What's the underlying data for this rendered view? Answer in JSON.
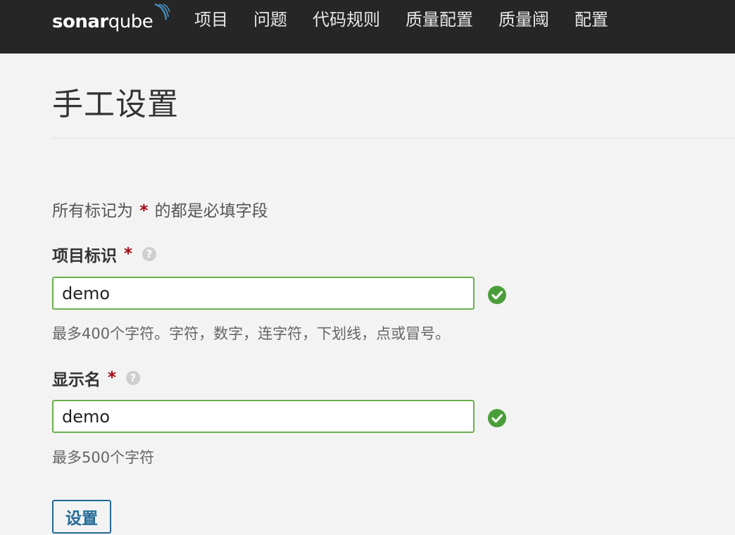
{
  "nav": {
    "logo": {
      "part1": "sonar",
      "part2": "qube"
    },
    "items": [
      {
        "label": "项目"
      },
      {
        "label": "问题"
      },
      {
        "label": "代码规则"
      },
      {
        "label": "质量配置"
      },
      {
        "label": "质量阈"
      },
      {
        "label": "配置"
      }
    ]
  },
  "page": {
    "title": "手工设置",
    "required_note_prefix": "所有标记为",
    "required_star": "*",
    "required_note_suffix": "的都是必填字段"
  },
  "form": {
    "project_key": {
      "label": "项目标识",
      "star": "*",
      "value": "demo",
      "hint": "最多400个字符。字符，数字，连字符，下划线，点或冒号。"
    },
    "display_name": {
      "label": "显示名",
      "star": "*",
      "value": "demo",
      "hint": "最多500个字符"
    },
    "submit_label": "设置"
  },
  "icons": {
    "help": "question-circle-icon",
    "valid": "check-circle-icon"
  },
  "colors": {
    "navbar": "#262626",
    "valid_green": "#6ab04c",
    "required_red": "#a4030f",
    "button_blue": "#236a97"
  }
}
